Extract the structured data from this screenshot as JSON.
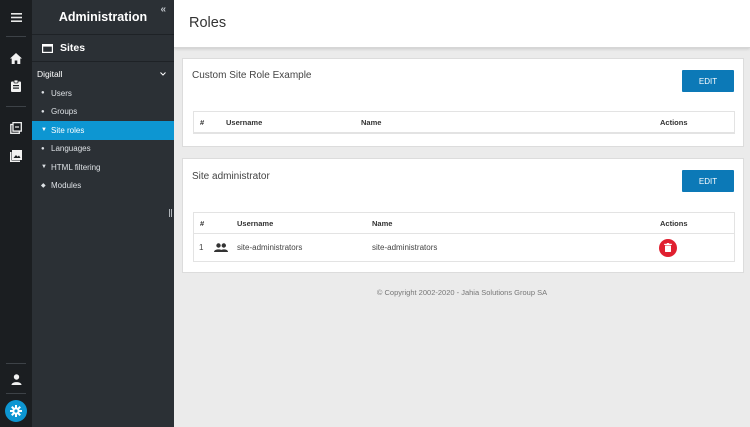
{
  "colors": {
    "accent": "#0d96d2",
    "button": "#0c79b7",
    "delete": "#e02030"
  },
  "rail": {
    "icons": [
      "menu-icon",
      "home-icon",
      "clipboard-icon",
      "site-content-icon",
      "image-icon",
      "user-icon",
      "settings-icon"
    ]
  },
  "sidebar": {
    "title": "Administration",
    "collapse_glyph": "«",
    "section": "Sites",
    "site": "Digitall",
    "items": [
      {
        "label": "Users",
        "icon": "user-icon",
        "glyph": "●",
        "active": false
      },
      {
        "label": "Groups",
        "icon": "group-icon",
        "glyph": "●",
        "active": false
      },
      {
        "label": "Site roles",
        "icon": "roles-icon",
        "glyph": "▼",
        "active": true
      },
      {
        "label": "Languages",
        "icon": "globe-icon",
        "glyph": "●",
        "active": false
      },
      {
        "label": "HTML filtering",
        "icon": "filter-icon",
        "glyph": "▼",
        "active": false
      },
      {
        "label": "Modules",
        "icon": "modules-icon",
        "glyph": "◆",
        "active": false
      }
    ]
  },
  "header": {
    "title": "Roles"
  },
  "roles": [
    {
      "title": "Custom Site Role Example",
      "edit_label": "EDIT",
      "columns": {
        "num": "#",
        "username": "Username",
        "name": "Name",
        "actions": "Actions"
      },
      "rows": []
    },
    {
      "title": "Site administrator",
      "edit_label": "EDIT",
      "columns": {
        "num": "#",
        "username": "Username",
        "name": "Name",
        "actions": "Actions"
      },
      "rows": [
        {
          "num": "1",
          "icon": "group-icon",
          "username": "site-administrators",
          "name": "site-administrators"
        }
      ]
    }
  ],
  "footer": {
    "copyright": "© Copyright 2002-2020 - Jahia Solutions Group SA"
  }
}
